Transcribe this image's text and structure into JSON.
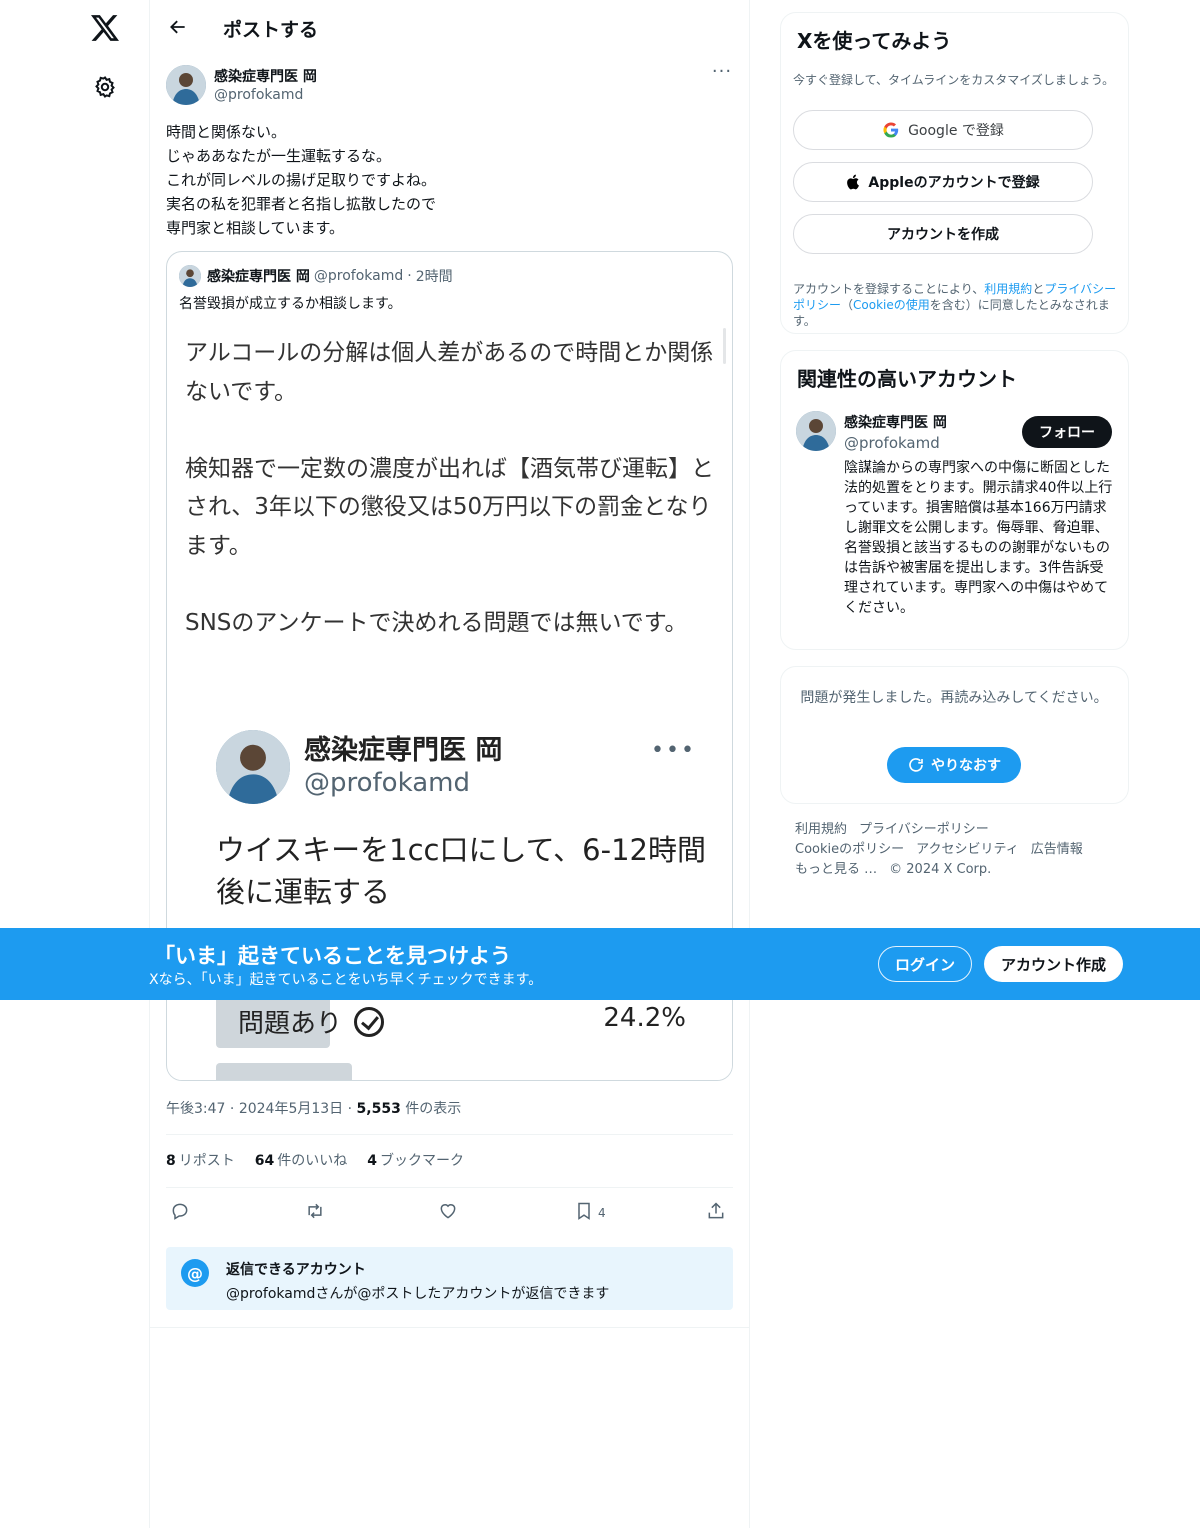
{
  "header": {
    "title": "ポストする"
  },
  "post": {
    "author_name": "感染症専門医 岡",
    "author_handle": "@profokamd",
    "text": "時間と関係ない。\nじゃああなたが一生運転するな。\nこれが同レベルの揚げ足取りですよね。\n実名の私を犯罪者と名指し拡散したので\n専門家と相談しています。",
    "quote": {
      "author_name": "感染症専門医 岡",
      "author_handle": "@profokamd",
      "time": "2時間",
      "text": "名誉毀損が成立するか相談します。",
      "image_text": "アルコールの分解は個人差があるので時間とか関係ないです。\n\n検知器で一定数の濃度が出れば【酒気帯び運転】とされ、3年以下の懲役又は50万円以下の罰金となります。\n\nSNSのアンケートで決めれる問題では無いです。",
      "inner_name": "感染症専門医 岡",
      "inner_handle": "@profokamd",
      "inner_text": "ウイスキーを1cc口にして、6-12時間後に運転する",
      "poll_option": "問題あり",
      "poll_percent": "24.2%",
      "poll_fraction": 0.242
    },
    "time": "午後3:47",
    "date": "2024年5月13日",
    "views_count": "5,553",
    "views_label": "件の表示",
    "reposts_count": "8",
    "reposts_label": "リポスト",
    "likes_count": "64",
    "likes_label": "件のいいね",
    "bookmarks_count": "4",
    "bookmarks_label": "ブックマーク",
    "bookmark_action_count": "4"
  },
  "reply_restriction": {
    "title": "返信できるアカウント",
    "text": "@profokamdさんが@ポストしたアカウントが返信できます"
  },
  "signup_card": {
    "title": "Xを使ってみよう",
    "subtitle": "今すぐ登録して、タイムラインをカスタマイズしましょう。",
    "google_label": "Google で登録",
    "apple_label": "Appleのアカウントで登録",
    "create_label": "アカウントを作成",
    "legal_prefix": "アカウントを登録することにより、",
    "legal_terms": "利用規約",
    "legal_and": "と",
    "legal_privacy": "プライバシーポリシー",
    "legal_open": "（",
    "legal_cookie": "Cookieの使用",
    "legal_suffix": "を含む）に同意したとみなされます。"
  },
  "relevant": {
    "title": "関連性の高いアカウント",
    "name": "感染症専門医 岡",
    "handle": "@profokamd",
    "follow_label": "フォロー",
    "bio": "陰謀論からの専門家への中傷に断固とした法的処置をとります。開示請求40件以上行っています。損害賠償は基本166万円請求し謝罪文を公開します。侮辱罪、脅迫罪、名誉毀損と該当するものの謝罪がないものは告訴や被害届を提出します。3件告訴受理されています。専門家への中傷はやめてください。"
  },
  "error_card": {
    "text": "問題が発生しました。再読み込みしてください。",
    "retry_label": "やりなおす"
  },
  "footer": {
    "links": [
      "利用規約",
      "プライバシーポリシー",
      "Cookieのポリシー",
      "アクセシビリティ",
      "広告情報",
      "もっと見る …",
      "© 2024 X Corp."
    ]
  },
  "banner": {
    "title": "「いま」起きていることを見つけよう",
    "subtitle": "Xなら、「いま」起きていることをいち早くチェックできます。",
    "login_label": "ログイン",
    "signup_label": "アカウント作成"
  },
  "colors": {
    "accent": "#1d9bf0",
    "text": "#0f1419",
    "muted": "#536471"
  },
  "icons": [
    "x-logo-icon",
    "gear-icon",
    "back-arrow-icon",
    "more-icon",
    "reply-icon",
    "repost-icon",
    "like-icon",
    "bookmark-icon",
    "share-icon",
    "google-icon",
    "apple-icon",
    "retry-icon",
    "mention-icon"
  ]
}
